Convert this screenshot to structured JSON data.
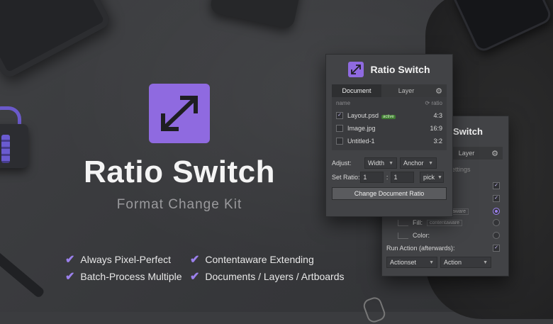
{
  "hero": {
    "title": "Ratio Switch",
    "subtitle": "Format Change Kit",
    "features": [
      "Always Pixel-Perfect",
      "Contentaware Extending",
      "Batch-Process Multiple",
      "Documents / Layers / Artboards"
    ]
  },
  "icons": {
    "app": "diagonal-resize-arrows-icon",
    "check": "checkmark-icon",
    "gear": "gear-icon",
    "refresh": "refresh-icon",
    "chevron": "chevron-down-icon"
  },
  "colors": {
    "accent": "#8f6ae0",
    "active_badge": "#3f7a33"
  },
  "panel_front": {
    "title": "Ratio Switch",
    "tabs": [
      "Document",
      "Layer"
    ],
    "list_head": {
      "name": "name",
      "ratio": "ratio"
    },
    "rows": [
      {
        "name": "Layout.psd",
        "badge": "active",
        "ratio": "4:3",
        "checked": true
      },
      {
        "name": "Image.jpg",
        "badge": "",
        "ratio": "16:9",
        "checked": false
      },
      {
        "name": "Untitled-1",
        "badge": "",
        "ratio": "3:2",
        "checked": false
      }
    ],
    "adjust_label": "Adjust:",
    "adjust_value": "Width",
    "anchor_value": "Anchor",
    "set_ratio_label": "Set Ratio:",
    "ratio_w": "1",
    "ratio_h": "1",
    "pick_value": "pick",
    "button": "Change Document Ratio"
  },
  "panel_back": {
    "title_partial": "Switch",
    "tab_partial": "Layer",
    "settings_partial": "ettings",
    "fill_tag": "contentaware",
    "fill_label": "Fill:",
    "fill_value": "contentaware",
    "color_label": "Color:",
    "run_action_label": "Run Action (afterwards):",
    "actionset": "Actionset",
    "action": "Action"
  }
}
